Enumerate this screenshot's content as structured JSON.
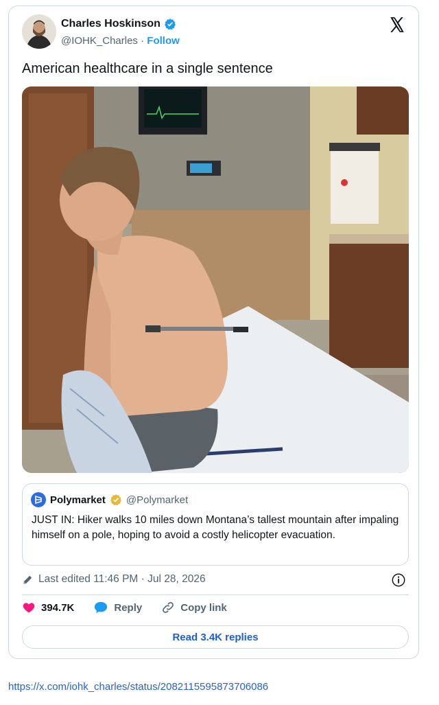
{
  "tweet": {
    "author_name": "Charles Hoskinson",
    "handle": "@IOHK_Charles",
    "separator": "·",
    "follow_label": "Follow",
    "text": "American healthcare in a single sentence",
    "image_alt": "Shirtless man seated on a hospital bed with a metal pole impaling his back"
  },
  "quote": {
    "author_name": "Polymarket",
    "handle": "@Polymarket",
    "text": "JUST IN: Hiker walks 10 miles down Montana’s tallest mountain after impaling himself on a pole, hoping to avoid a costly helicopter evacuation."
  },
  "meta": {
    "edited": "Last edited 11:46 PM · Jul 28, 2026"
  },
  "actions": {
    "likes": "394.7K",
    "reply_label": "Reply",
    "copy_label": "Copy link",
    "read_replies": "Read 3.4K replies"
  },
  "footer": {
    "url": "https://x.com/iohk_charles/status/2082115595873706086"
  },
  "colors": {
    "accent_blue": "#1d9bf0",
    "like_pink": "#f91880",
    "verified_gold": "#e8b83a"
  },
  "icons": [
    "verified-badge-icon",
    "x-logo-icon",
    "polymarket-logo-icon",
    "pencil-icon",
    "info-icon",
    "heart-icon",
    "reply-bubble-icon",
    "link-icon"
  ]
}
